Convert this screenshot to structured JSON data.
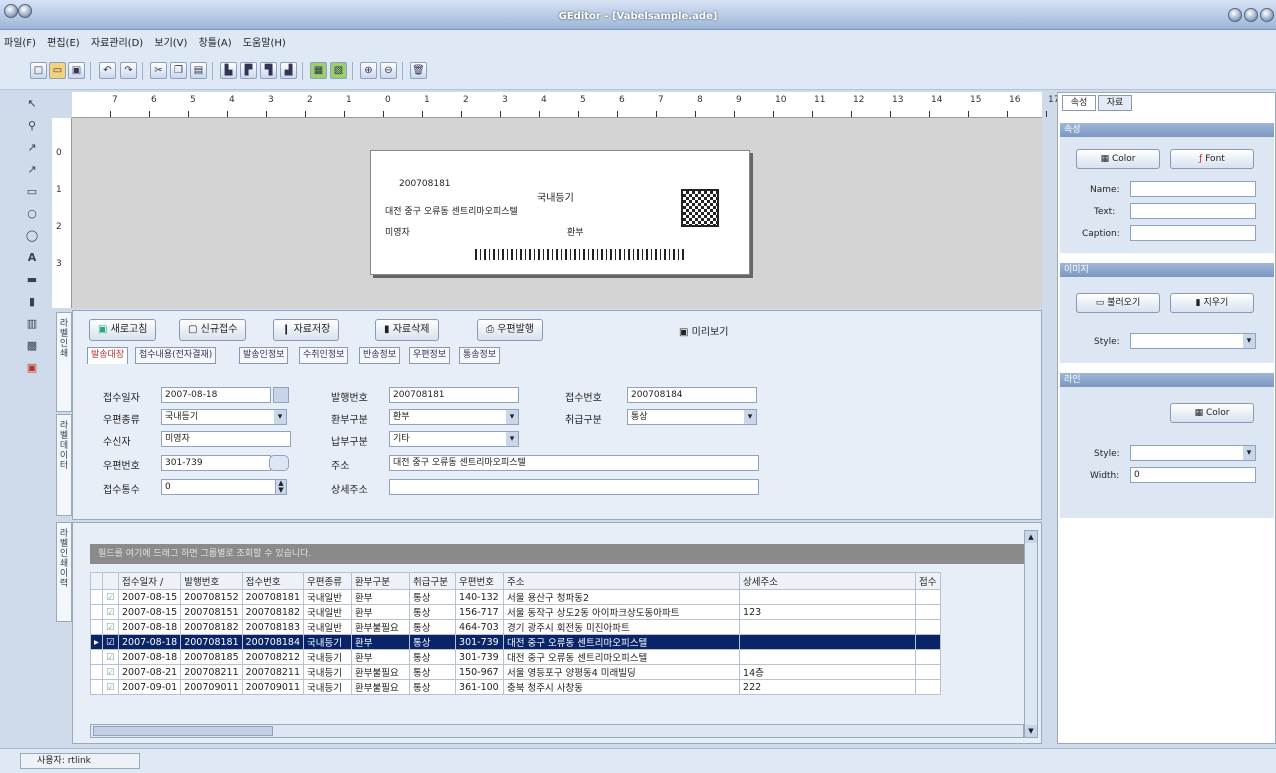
{
  "window": {
    "title": "GEditor - [Vabelsample.ade]"
  },
  "menu": [
    "파일(F)",
    "편집(E)",
    "자료관리(D)",
    "보기(V)",
    "창틀(A)",
    "도움말(H)"
  ],
  "toolbar": [
    "new-icon",
    "open-icon",
    "save-icon",
    "undo-icon",
    "redo-icon",
    "cut-icon",
    "copy-icon",
    "paste-icon",
    "layer1-icon",
    "layer2-icon",
    "layer3-icon",
    "layer4-icon",
    "green1-icon",
    "green2-icon",
    "zoom-in-icon",
    "zoom-out-icon",
    "delete-icon"
  ],
  "ruler": {
    "h": [
      "7",
      "6",
      "5",
      "4",
      "3",
      "2",
      "1",
      "0",
      "1",
      "2",
      "3",
      "4",
      "5",
      "6",
      "7",
      "8",
      "9",
      "10",
      "11",
      "12",
      "13",
      "14",
      "15",
      "16",
      "17"
    ],
    "v": [
      "0",
      "1",
      "2",
      "3"
    ]
  },
  "label_preview": {
    "line1": "200708181",
    "line2": "국내등기",
    "line3": "대전 중구 오류동 센트리마오피스텔",
    "line4": "미영자",
    "line5": "환부"
  },
  "vtabs": {
    "tab1": "라벨인쇄",
    "tab2": "라벨데이터",
    "tab3": "라벨인쇄이력"
  },
  "form": {
    "buttons": {
      "refresh": "새로고침",
      "new": "신규접수",
      "save": "자료저장",
      "delete": "자료삭제",
      "print": "우편발행"
    },
    "preview_label": "미리보기",
    "tabs": [
      "발송대장",
      "접수내용(전자결재)",
      "발송인정보",
      "수취인정보",
      "반송정보",
      "우편정보",
      "통송정보"
    ],
    "fields": {
      "recv_date_label": "접수일자",
      "recv_date": "2007-08-18",
      "issue_no_label": "발행번호",
      "issue_no": "200708181",
      "recv_no_label": "접수번호",
      "recv_no": "200708184",
      "mail_type_label": "우편종류",
      "mail_type": "국내등기",
      "return_type_label": "환부구분",
      "return_type": "환부",
      "handle_type_label": "취급구분",
      "handle_type": "통상",
      "receiver_label": "수신자",
      "receiver": "미영자",
      "pay_type_label": "납부구분",
      "pay_type": "기타",
      "zip_label": "우편번호",
      "zip": "301-739",
      "addr_label": "주소",
      "addr": "대전 중구 오류동 센트리마오피스텔",
      "count_label": "접수통수",
      "count": "0",
      "addr_detail_label": "상세주소",
      "addr_detail": ""
    }
  },
  "grid": {
    "hint": "필드를 여기에 드래그 하면 그룹별로 조회할 수 있습니다.",
    "columns": [
      "",
      "접수일자 /",
      "발행번호",
      "접수번호",
      "우편종류",
      "환부구분",
      "취급구분",
      "우편번호",
      "주소",
      "상세주소",
      "접수"
    ],
    "rows": [
      [
        "2007-08-15",
        "200708152",
        "200708181",
        "국내일반",
        "환부",
        "통상",
        "140-132",
        "서울 용산구 청파동2",
        ""
      ],
      [
        "2007-08-15",
        "200708151",
        "200708182",
        "국내일반",
        "환부",
        "통상",
        "156-717",
        "서울 동작구 상도2동 아이파크상도동아파트",
        "123"
      ],
      [
        "2007-08-18",
        "200708182",
        "200708183",
        "국내일반",
        "환부불필요",
        "통상",
        "464-703",
        "경기 광주시 회전동 미진아파트",
        ""
      ],
      [
        "2007-08-18",
        "200708181",
        "200708184",
        "국내등기",
        "환부",
        "통상",
        "301-739",
        "대전 중구 오류동 센트리마오피스텔",
        ""
      ],
      [
        "2007-08-18",
        "200708185",
        "200708212",
        "국내등기",
        "환부",
        "통상",
        "301-739",
        "대전 중구 오류동 센트리마오피스텔",
        ""
      ],
      [
        "2007-08-21",
        "200708211",
        "200708211",
        "국내등기",
        "환부불필요",
        "통상",
        "150-967",
        "서울 영등포구 양평동4 미래빌딩",
        "14층"
      ],
      [
        "2007-09-01",
        "200709011",
        "200709011",
        "국내등기",
        "환부불필요",
        "통상",
        "361-100",
        "충북 청주시 사창동",
        "222"
      ]
    ]
  },
  "right": {
    "tabs": [
      "속성",
      "자료"
    ],
    "sec1_title": "속성",
    "color_btn": "Color",
    "font_btn": "Font",
    "name_label": "Name:",
    "text_label": "Text:",
    "caption_label": "Caption:",
    "sec2_title": "이미지",
    "load_btn": "불러오기",
    "clear_btn": "지우기",
    "style_label": "Style:",
    "sec3_title": "라인",
    "color2_btn": "Color",
    "style2_label": "Style:",
    "width_label": "Width:",
    "width_val": "0"
  },
  "status": {
    "user": "사용자: rtlink"
  }
}
